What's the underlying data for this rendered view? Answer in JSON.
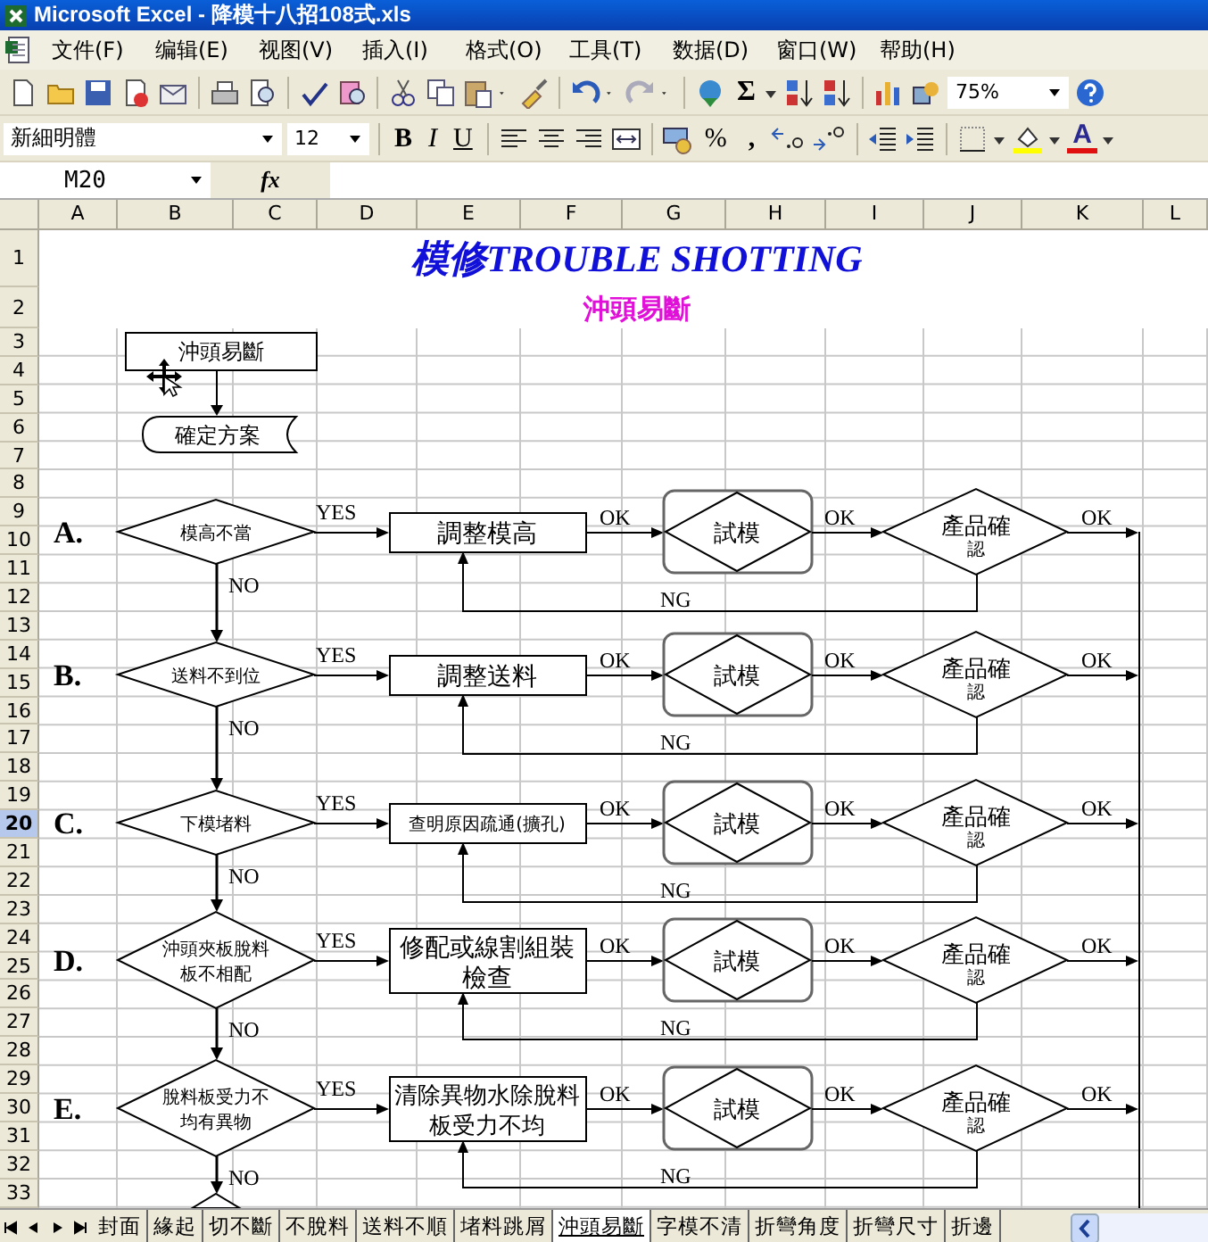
{
  "window": {
    "title": "Microsoft Excel - 降模十八招108式.xls"
  },
  "menu": [
    "文件(F)",
    "编辑(E)",
    "视图(V)",
    "插入(I)",
    "格式(O)",
    "工具(T)",
    "数据(D)",
    "窗口(W)",
    "帮助(H)"
  ],
  "standard_toolbar": {
    "sum": "Σ",
    "zoom": "75%"
  },
  "formatting_toolbar": {
    "font": "新細明體",
    "font_size": "12",
    "bold": "B",
    "italic": "I",
    "underline": "U",
    "percent": "%",
    "comma": ",",
    "font_color": "A"
  },
  "formula_bar": {
    "name_box": "M20",
    "function_label": "fx"
  },
  "columns": [
    "A",
    "B",
    "C",
    "D",
    "E",
    "F",
    "G",
    "H",
    "I",
    "J",
    "K",
    "L"
  ],
  "rows": [
    {
      "label": "1",
      "selected": false
    },
    {
      "label": "2",
      "selected": false
    },
    {
      "label": "3",
      "selected": false
    },
    {
      "label": "4",
      "selected": false
    },
    {
      "label": "5",
      "selected": false
    },
    {
      "label": "6",
      "selected": false
    },
    {
      "label": "7",
      "selected": false
    },
    {
      "label": "8",
      "selected": false
    },
    {
      "label": "9",
      "selected": false
    },
    {
      "label": "10",
      "selected": false
    },
    {
      "label": "11",
      "selected": false
    },
    {
      "label": "12",
      "selected": false
    },
    {
      "label": "13",
      "selected": false
    },
    {
      "label": "14",
      "selected": false
    },
    {
      "label": "15",
      "selected": false
    },
    {
      "label": "16",
      "selected": false
    },
    {
      "label": "17",
      "selected": false
    },
    {
      "label": "18",
      "selected": false
    },
    {
      "label": "19",
      "selected": false
    },
    {
      "label": "20",
      "selected": true
    },
    {
      "label": "21",
      "selected": false
    },
    {
      "label": "22",
      "selected": false
    },
    {
      "label": "23",
      "selected": false
    },
    {
      "label": "24",
      "selected": false
    },
    {
      "label": "25",
      "selected": false
    },
    {
      "label": "26",
      "selected": false
    },
    {
      "label": "27",
      "selected": false
    },
    {
      "label": "28",
      "selected": false
    },
    {
      "label": "29",
      "selected": false
    },
    {
      "label": "30",
      "selected": false
    },
    {
      "label": "31",
      "selected": false
    },
    {
      "label": "32",
      "selected": false
    },
    {
      "label": "33",
      "selected": false
    }
  ],
  "sheet": {
    "title": "模修TROUBLE SHOTTING",
    "subtitle": "沖頭易斷",
    "start": "沖頭易斷",
    "solution": "確定方案",
    "steps": [
      {
        "letter": "A.",
        "check": [
          "模高不當"
        ],
        "yes": "YES",
        "action": [
          "調整模高"
        ],
        "ok1": "OK",
        "trial": "試模",
        "ok2": "OK",
        "confirm": [
          "產品確",
          "認"
        ],
        "ok3": "OK",
        "ng": "NG",
        "no": "NO"
      },
      {
        "letter": "B.",
        "check": [
          "送料不到位"
        ],
        "yes": "YES",
        "action": [
          "調整送料"
        ],
        "ok1": "OK",
        "trial": "試模",
        "ok2": "OK",
        "confirm": [
          "產品確",
          "認"
        ],
        "ok3": "OK",
        "ng": "NG",
        "no": "NO"
      },
      {
        "letter": "C.",
        "check": [
          "下模堵料"
        ],
        "yes": "YES",
        "action": [
          "查明原因疏通(擴孔)"
        ],
        "ok1": "OK",
        "trial": "試模",
        "ok2": "OK",
        "confirm": [
          "產品確",
          "認"
        ],
        "ok3": "OK",
        "ng": "NG",
        "no": "NO"
      },
      {
        "letter": "D.",
        "check": [
          "沖頭夾板脫料",
          "板不相配"
        ],
        "yes": "YES",
        "action": [
          "修配或線割組裝",
          "檢查"
        ],
        "ok1": "OK",
        "trial": "試模",
        "ok2": "OK",
        "confirm": [
          "產品確",
          "認"
        ],
        "ok3": "OK",
        "ng": "NG",
        "no": "NO"
      },
      {
        "letter": "E.",
        "check": [
          "脫料板受力不",
          "均有異物"
        ],
        "yes": "YES",
        "action": [
          "清除異物水除脫料",
          "板受力不均"
        ],
        "ok1": "OK",
        "trial": "試模",
        "ok2": "OK",
        "confirm": [
          "產品確",
          "認"
        ],
        "ok3": "OK",
        "ng": "NG",
        "no": "NO"
      }
    ]
  },
  "sheet_tabs": [
    {
      "label": "封面",
      "selected": false
    },
    {
      "label": "緣起",
      "selected": false
    },
    {
      "label": "切不斷",
      "selected": false
    },
    {
      "label": "不脫料",
      "selected": false
    },
    {
      "label": "送料不順",
      "selected": false
    },
    {
      "label": "堵料跳屑",
      "selected": false
    },
    {
      "label": "沖頭易斷",
      "selected": true
    },
    {
      "label": "字模不清",
      "selected": false
    },
    {
      "label": "折彎角度",
      "selected": false
    },
    {
      "label": "折彎尺寸",
      "selected": false
    },
    {
      "label": "折邊",
      "selected": false
    }
  ]
}
